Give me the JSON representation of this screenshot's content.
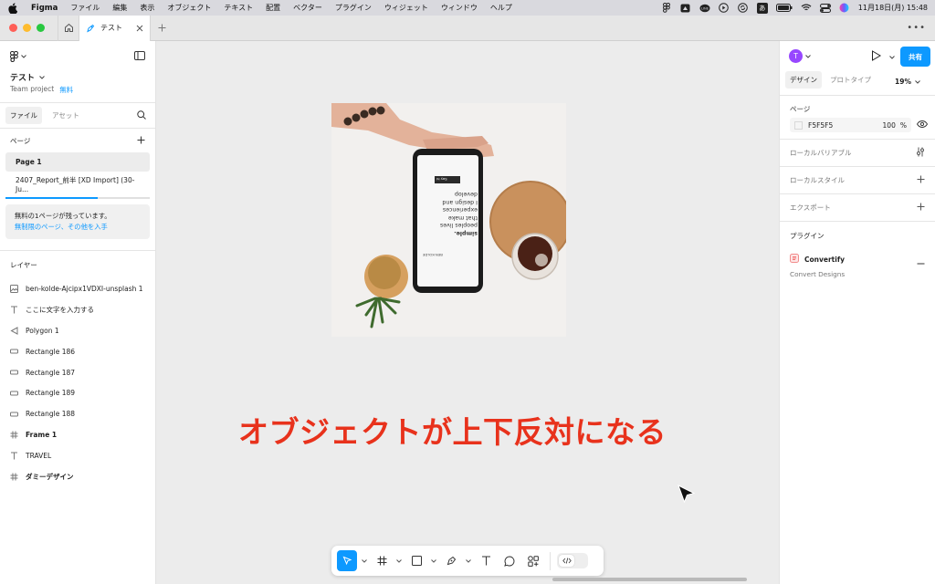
{
  "menubar": {
    "app_name": "Figma",
    "items": [
      "ファイル",
      "編集",
      "表示",
      "オブジェクト",
      "テキスト",
      "配置",
      "ベクター",
      "プラグイン",
      "ウィジェット",
      "ウィンドウ",
      "ヘルプ"
    ],
    "clock": "11月18日(月)  15:48",
    "input_mode": "あ"
  },
  "tabbar": {
    "tab_label": "テスト"
  },
  "left_panel": {
    "file_title": "テスト",
    "team": "Team project",
    "plan_badge": "無料",
    "tabs": [
      "ファイル",
      "アセット"
    ],
    "pages_label": "ページ",
    "pages": [
      "Page 1",
      "2407_Report_前半  [XD Import] (30-Ju..."
    ],
    "page_progress": 0.64,
    "notice_text": "無料の1ページが残っています。",
    "notice_link": "無制限のページ、その他を入手",
    "layers_label": "レイヤー",
    "layers": [
      {
        "name": "ben-kolde-Ajcipx1VDXI-unsplash 1",
        "icon": "image-icon"
      },
      {
        "name": "ここに文字を入力する",
        "icon": "text-icon"
      },
      {
        "name": "Polygon 1",
        "icon": "polygon-icon"
      },
      {
        "name": "Rectangle 186",
        "icon": "rectangle-icon"
      },
      {
        "name": "Rectangle 187",
        "icon": "rectangle-icon"
      },
      {
        "name": "Rectangle 189",
        "icon": "rectangle-icon"
      },
      {
        "name": "Rectangle 188",
        "icon": "rectangle-icon"
      },
      {
        "name": "Frame 1",
        "icon": "frame-icon"
      },
      {
        "name": "TRAVEL",
        "icon": "text-icon"
      },
      {
        "name": "ダミーデザイン",
        "icon": "frame-icon"
      }
    ]
  },
  "canvas": {
    "overlay_text": "オブジェクトが上下反対になる",
    "phone_text_lines": [
      "simple.",
      "peoples lives",
      "that make",
      "experiences",
      "I design and",
      "develop"
    ],
    "phone_caption": "BEN KOLDE",
    "phone_button": "Say hi",
    "help_label": "?"
  },
  "right_panel": {
    "avatar_letter": "T",
    "share_label": "共有",
    "tabs": [
      "デザイン",
      "プロトタイプ"
    ],
    "zoom": "19%",
    "page_label": "ページ",
    "page_fill_hex": "F5F5F5",
    "page_fill_opacity": "100",
    "page_fill_pct": "%",
    "local_variables": "ローカルバリアブル",
    "local_styles": "ローカルスタイル",
    "export": "エクスポート",
    "plugins_label": "プラグイン",
    "plugin_name": "Convertify",
    "plugin_sub": "Convert Designs"
  },
  "colors": {
    "accent": "#0d99ff",
    "overlay_text": "#e8321c",
    "canvas_bg": "#ececec"
  }
}
